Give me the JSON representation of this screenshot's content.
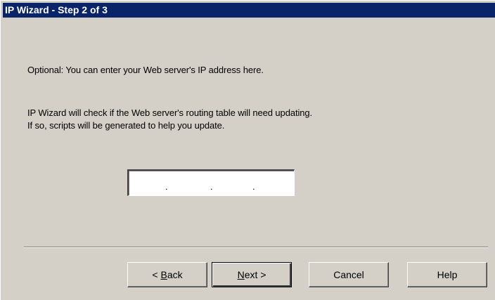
{
  "window": {
    "title": "IP Wizard - Step 2 of 3"
  },
  "content": {
    "line1": "Optional:  You can enter your Web server's IP address here.",
    "line2": "IP Wizard will check if the Web server's routing table will need updating.",
    "line3": "If so, scripts will be generated to help you update."
  },
  "ip_address": {
    "value": "",
    "separator": "."
  },
  "buttons": {
    "back": {
      "pre": "< ",
      "accel": "B",
      "post": "ack"
    },
    "next": {
      "pre": "",
      "accel": "N",
      "post": "ext >"
    },
    "cancel": "Cancel",
    "help": "Help"
  },
  "colors": {
    "titlebar": "#0a246a",
    "dialog_bg": "#d4d0c8"
  }
}
